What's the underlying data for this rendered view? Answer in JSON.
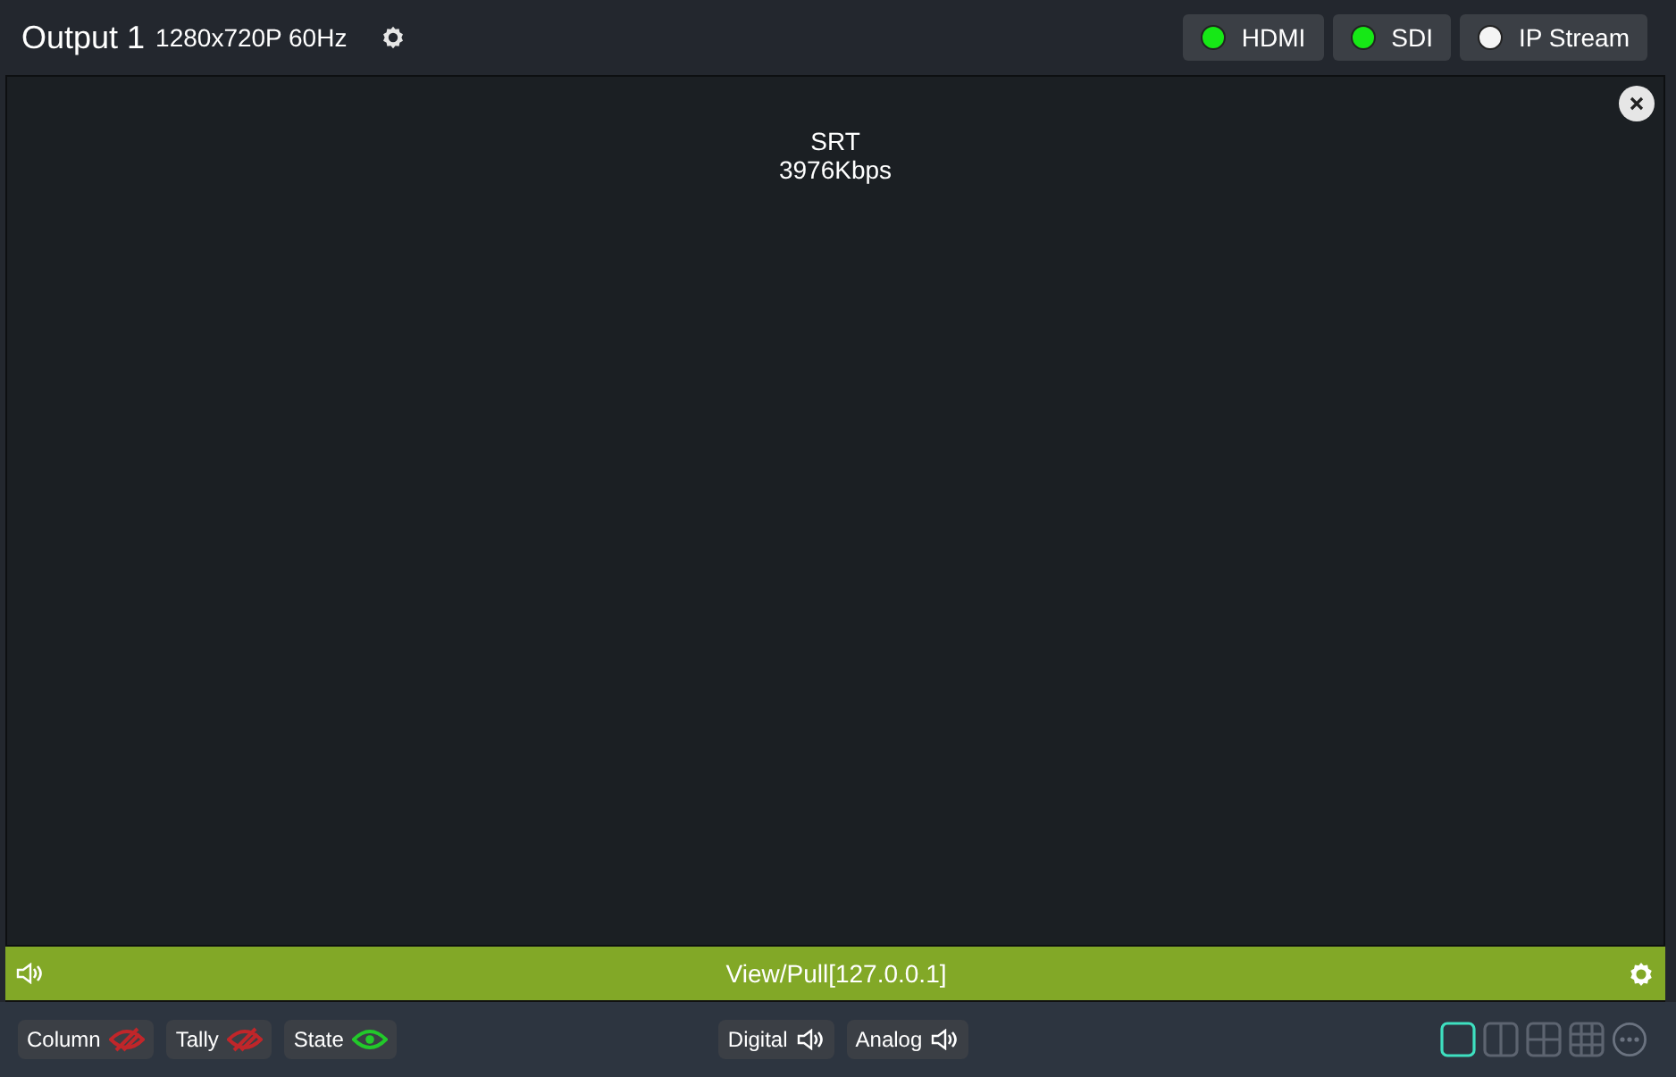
{
  "header": {
    "title": "Output 1",
    "format": "1280x720P 60Hz"
  },
  "outputs": [
    {
      "label": "HDMI",
      "on": true
    },
    {
      "label": "SDI",
      "on": true
    },
    {
      "label": "IP Stream",
      "on": false
    }
  ],
  "preview": {
    "protocol": "SRT",
    "bitrate": "3976Kbps"
  },
  "source_bar": {
    "label": "View/Pull[127.0.0.1]"
  },
  "overlays": [
    {
      "label": "Column",
      "visible": false
    },
    {
      "label": "Tally",
      "visible": false
    },
    {
      "label": "State",
      "visible": true
    }
  ],
  "audio": [
    {
      "label": "Digital"
    },
    {
      "label": "Analog"
    }
  ],
  "layouts": [
    {
      "kind": "single",
      "selected": true
    },
    {
      "kind": "split",
      "selected": false
    },
    {
      "kind": "quad",
      "selected": false
    },
    {
      "kind": "grid",
      "selected": false
    }
  ]
}
